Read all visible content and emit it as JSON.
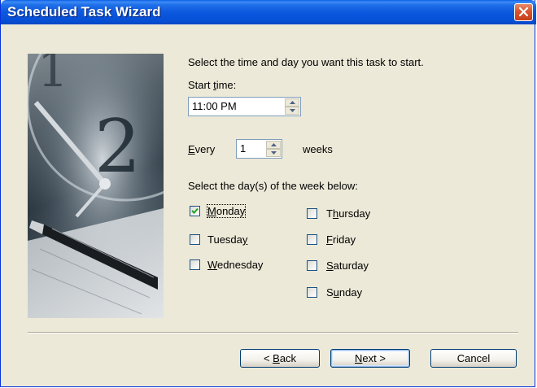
{
  "window": {
    "title": "Scheduled Task Wizard"
  },
  "intro": "Select the time and day you want this task to start.",
  "start_time": {
    "label_pre": "Start ",
    "label_key": "t",
    "label_post": "ime:",
    "value": "11:00 PM"
  },
  "every": {
    "label_key": "E",
    "label_post": "very",
    "value": "1",
    "unit": "weeks"
  },
  "days_prompt": "Select the day(s) of the week below:",
  "days": [
    {
      "pre": "",
      "key": "M",
      "post": "onday",
      "checked": true
    },
    {
      "pre": "Tuesda",
      "key": "y",
      "post": "",
      "checked": false
    },
    {
      "pre": "",
      "key": "W",
      "post": "ednesday",
      "checked": false
    },
    {
      "pre": "T",
      "key": "h",
      "post": "ursday",
      "checked": false
    },
    {
      "pre": "",
      "key": "F",
      "post": "riday",
      "checked": false
    },
    {
      "pre": "",
      "key": "S",
      "post": "aturday",
      "checked": false
    },
    {
      "pre": "S",
      "key": "u",
      "post": "nday",
      "checked": false
    }
  ],
  "buttons": {
    "back": {
      "pre": "< ",
      "key": "B",
      "post": "ack"
    },
    "next": {
      "pre": "",
      "key": "N",
      "post": "ext >"
    },
    "cancel": "Cancel"
  },
  "icons": {
    "close": "close-icon",
    "spin_up": "arrow-up-icon",
    "spin_down": "arrow-down-icon",
    "check": "checkmark-icon"
  },
  "colors": {
    "titlebar": "#0a5fe6",
    "dialog_bg": "#ece9d8",
    "close_button": "#d9542e"
  }
}
